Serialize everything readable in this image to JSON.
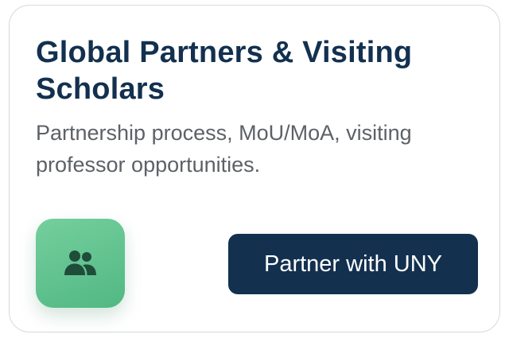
{
  "card": {
    "title": "Global Partners & Visiting Scholars",
    "description": "Partnership process, MoU/MoA, visiting professor opportunities.",
    "icon": "users-icon",
    "button_label": "Partner with UNY"
  },
  "colors": {
    "title": "#13304f",
    "description": "#5d6167",
    "icon_tile": "#5fc28e",
    "icon_glyph": "#1f4d3a",
    "button_background": "#13304f",
    "button_text": "#ffffff",
    "card_border": "#d6d9de"
  }
}
